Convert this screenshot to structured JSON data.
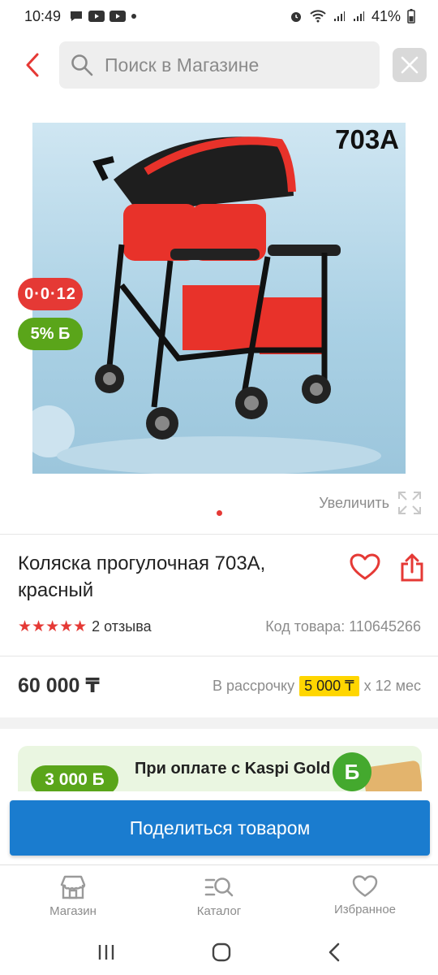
{
  "status_bar": {
    "time": "10:49",
    "battery": "41%"
  },
  "header": {
    "search_placeholder": "Поиск в Магазине"
  },
  "product": {
    "image_model_text": "703A",
    "badge_installment": "0·0·12",
    "badge_bonus": "5% Б",
    "zoom_label": "Увеличить",
    "title": "Коляска прогулочная 703А, красный",
    "rating_stars": "★★★★★",
    "reviews": "2 отзыва",
    "code": "Код товара: 110645266",
    "price": "60 000 ₸",
    "installment_prefix": "В рассрочку",
    "installment_amount": "5 000 ₸",
    "installment_suffix": "х 12 мес"
  },
  "promo": {
    "bonus_amount": "3 000 Б",
    "text": "При оплате с Kaspi Gold",
    "coin_letter": "Б"
  },
  "share_button": "Поделиться товаром",
  "bottom_nav": [
    {
      "label": "Магазин",
      "icon": "shop-icon"
    },
    {
      "label": "Каталог",
      "icon": "catalog-search-icon"
    },
    {
      "label": "Избранное",
      "icon": "heart-icon"
    }
  ],
  "colors": {
    "accent_red": "#e53935",
    "kaspi_green": "#5aa51a",
    "primary_blue": "#1a7ccf",
    "installment_yellow": "#ffd600"
  }
}
